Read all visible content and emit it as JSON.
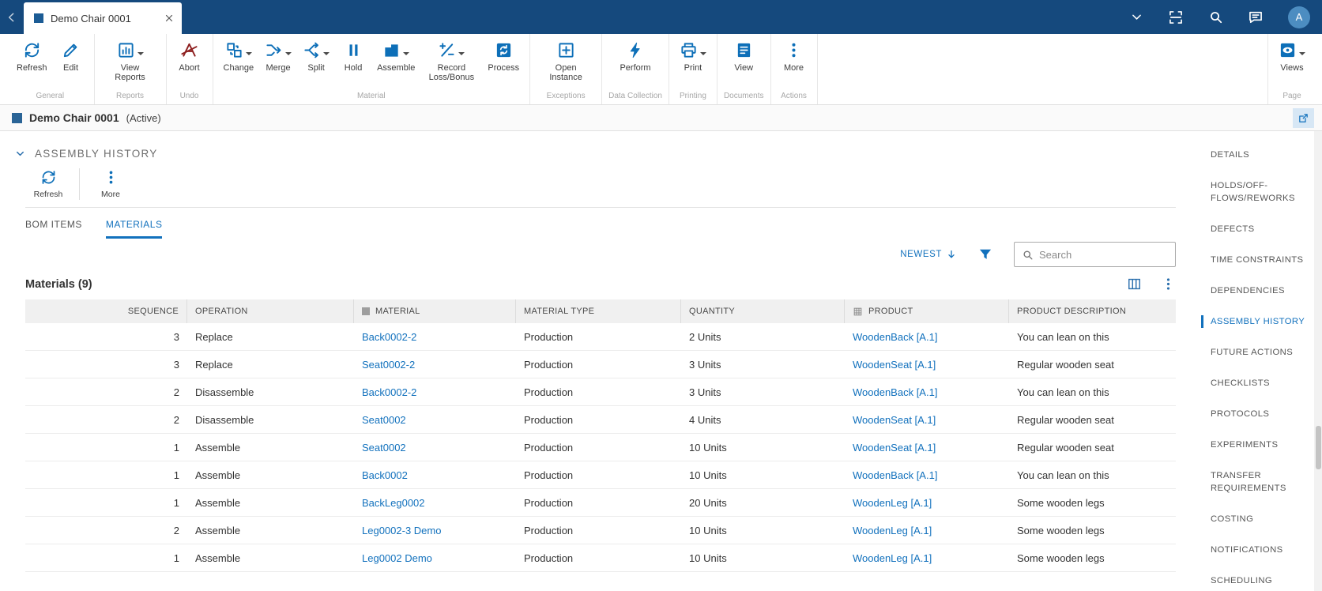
{
  "topbar": {
    "tab_title": "Demo Chair 0001",
    "avatar_initial": "A"
  },
  "ribbon": {
    "groups": [
      {
        "label": "General",
        "buttons": [
          {
            "label": "Refresh",
            "icon": "refresh-icon"
          },
          {
            "label": "Edit",
            "icon": "edit-icon"
          }
        ]
      },
      {
        "label": "Reports",
        "buttons": [
          {
            "label": "View Reports",
            "icon": "view-reports-icon",
            "dropdown": true
          }
        ]
      },
      {
        "label": "Undo",
        "buttons": [
          {
            "label": "Abort",
            "icon": "abort-icon"
          }
        ]
      },
      {
        "label": "Material",
        "buttons": [
          {
            "label": "Change",
            "icon": "change-icon",
            "dropdown": true
          },
          {
            "label": "Merge",
            "icon": "merge-icon",
            "dropdown": true
          },
          {
            "label": "Split",
            "icon": "split-icon",
            "dropdown": true
          },
          {
            "label": "Hold",
            "icon": "hold-icon"
          },
          {
            "label": "Assemble",
            "icon": "assemble-icon",
            "dropdown": true
          },
          {
            "label": "Record Loss/Bonus",
            "icon": "record-loss-bonus-icon",
            "dropdown": true
          },
          {
            "label": "Process",
            "icon": "process-icon"
          }
        ]
      },
      {
        "label": "Exceptions",
        "buttons": [
          {
            "label": "Open Instance",
            "icon": "open-instance-icon"
          }
        ]
      },
      {
        "label": "Data Collection",
        "buttons": [
          {
            "label": "Perform",
            "icon": "perform-icon"
          }
        ]
      },
      {
        "label": "Printing",
        "buttons": [
          {
            "label": "Print",
            "icon": "print-icon",
            "dropdown": true
          }
        ]
      },
      {
        "label": "Documents",
        "buttons": [
          {
            "label": "View",
            "icon": "view-documents-icon"
          }
        ]
      },
      {
        "label": "Actions",
        "buttons": [
          {
            "label": "More",
            "icon": "more-icon"
          }
        ]
      }
    ],
    "page_group": {
      "label": "Page",
      "button": {
        "label": "Views",
        "icon": "views-icon",
        "dropdown": true
      }
    }
  },
  "entity_header": {
    "title": "Demo Chair 0001",
    "status": "(Active)"
  },
  "assembly_panel": {
    "section_title": "ASSEMBLY HISTORY",
    "toolbar": {
      "refresh_label": "Refresh",
      "more_label": "More"
    },
    "tabs": [
      {
        "label": "BOM ITEMS",
        "active": false
      },
      {
        "label": "MATERIALS",
        "active": true
      }
    ],
    "sort_label": "NEWEST",
    "search_placeholder": "Search",
    "table": {
      "title": "Materials (9)",
      "columns": [
        "SEQUENCE",
        "OPERATION",
        "MATERIAL",
        "MATERIAL TYPE",
        "QUANTITY",
        "PRODUCT",
        "PRODUCT DESCRIPTION"
      ],
      "rows": [
        {
          "sequence": "3",
          "operation": "Replace",
          "material": "Back0002-2",
          "material_type": "Production",
          "quantity": "2 Units",
          "product": "WoodenBack [A.1]",
          "product_description": "You can lean on this"
        },
        {
          "sequence": "3",
          "operation": "Replace",
          "material": "Seat0002-2",
          "material_type": "Production",
          "quantity": "3 Units",
          "product": "WoodenSeat [A.1]",
          "product_description": "Regular wooden seat"
        },
        {
          "sequence": "2",
          "operation": "Disassemble",
          "material": "Back0002-2",
          "material_type": "Production",
          "quantity": "3 Units",
          "product": "WoodenBack [A.1]",
          "product_description": "You can lean on this"
        },
        {
          "sequence": "2",
          "operation": "Disassemble",
          "material": "Seat0002",
          "material_type": "Production",
          "quantity": "4 Units",
          "product": "WoodenSeat [A.1]",
          "product_description": "Regular wooden seat"
        },
        {
          "sequence": "1",
          "operation": "Assemble",
          "material": "Seat0002",
          "material_type": "Production",
          "quantity": "10 Units",
          "product": "WoodenSeat [A.1]",
          "product_description": "Regular wooden seat"
        },
        {
          "sequence": "1",
          "operation": "Assemble",
          "material": "Back0002",
          "material_type": "Production",
          "quantity": "10 Units",
          "product": "WoodenBack [A.1]",
          "product_description": "You can lean on this"
        },
        {
          "sequence": "1",
          "operation": "Assemble",
          "material": "BackLeg0002",
          "material_type": "Production",
          "quantity": "20 Units",
          "product": "WoodenLeg [A.1]",
          "product_description": "Some wooden legs"
        },
        {
          "sequence": "2",
          "operation": "Assemble",
          "material": "Leg0002-3 Demo",
          "material_type": "Production",
          "quantity": "10 Units",
          "product": "WoodenLeg [A.1]",
          "product_description": "Some wooden legs"
        },
        {
          "sequence": "1",
          "operation": "Assemble",
          "material": "Leg0002 Demo",
          "material_type": "Production",
          "quantity": "10 Units",
          "product": "WoodenLeg [A.1]",
          "product_description": "Some wooden legs"
        }
      ]
    }
  },
  "sidebar": {
    "items": [
      {
        "label": "DETAILS",
        "active": false
      },
      {
        "label": "HOLDS/OFF-FLOWS/REWORKS",
        "active": false
      },
      {
        "label": "DEFECTS",
        "active": false
      },
      {
        "label": "TIME CONSTRAINTS",
        "active": false
      },
      {
        "label": "DEPENDENCIES",
        "active": false
      },
      {
        "label": "ASSEMBLY HISTORY",
        "active": true
      },
      {
        "label": "FUTURE ACTIONS",
        "active": false
      },
      {
        "label": "CHECKLISTS",
        "active": false
      },
      {
        "label": "PROTOCOLS",
        "active": false
      },
      {
        "label": "EXPERIMENTS",
        "active": false
      },
      {
        "label": "TRANSFER REQUIREMENTS",
        "active": false
      },
      {
        "label": "COSTING",
        "active": false
      },
      {
        "label": "NOTIFICATIONS",
        "active": false
      },
      {
        "label": "SCHEDULING",
        "active": false
      }
    ]
  },
  "colors": {
    "topbar_bg": "#15497D",
    "icon_blue": "#0D6FB8",
    "link_blue": "#1271BD",
    "abort_red": "#8E2020",
    "table_header_bg": "#F0F0F0",
    "active_accent": "#1271BD"
  },
  "icons": {
    "refresh-icon": "circular-arrows",
    "edit-icon": "pencil",
    "view-reports-icon": "bar-chart-box",
    "abort-icon": "struck-letter-a",
    "change-icon": "swap-squares",
    "merge-icon": "merging-arrows",
    "split-icon": "splitting-arrows",
    "hold-icon": "pause-bars",
    "assemble-icon": "stacked-blocks",
    "record-loss-bonus-icon": "plus-minus-slash",
    "process-icon": "sync-square",
    "open-instance-icon": "plus-in-box",
    "perform-icon": "lightning-bolt",
    "print-icon": "printer",
    "view-documents-icon": "document-lines",
    "more-icon": "vertical-ellipsis",
    "views-icon": "eye-in-square",
    "search-icon": "magnifier",
    "feedback-icon": "speech-bubble",
    "scan-icon": "scan-brackets",
    "filter-icon": "funnel",
    "columns-icon": "table-columns"
  }
}
